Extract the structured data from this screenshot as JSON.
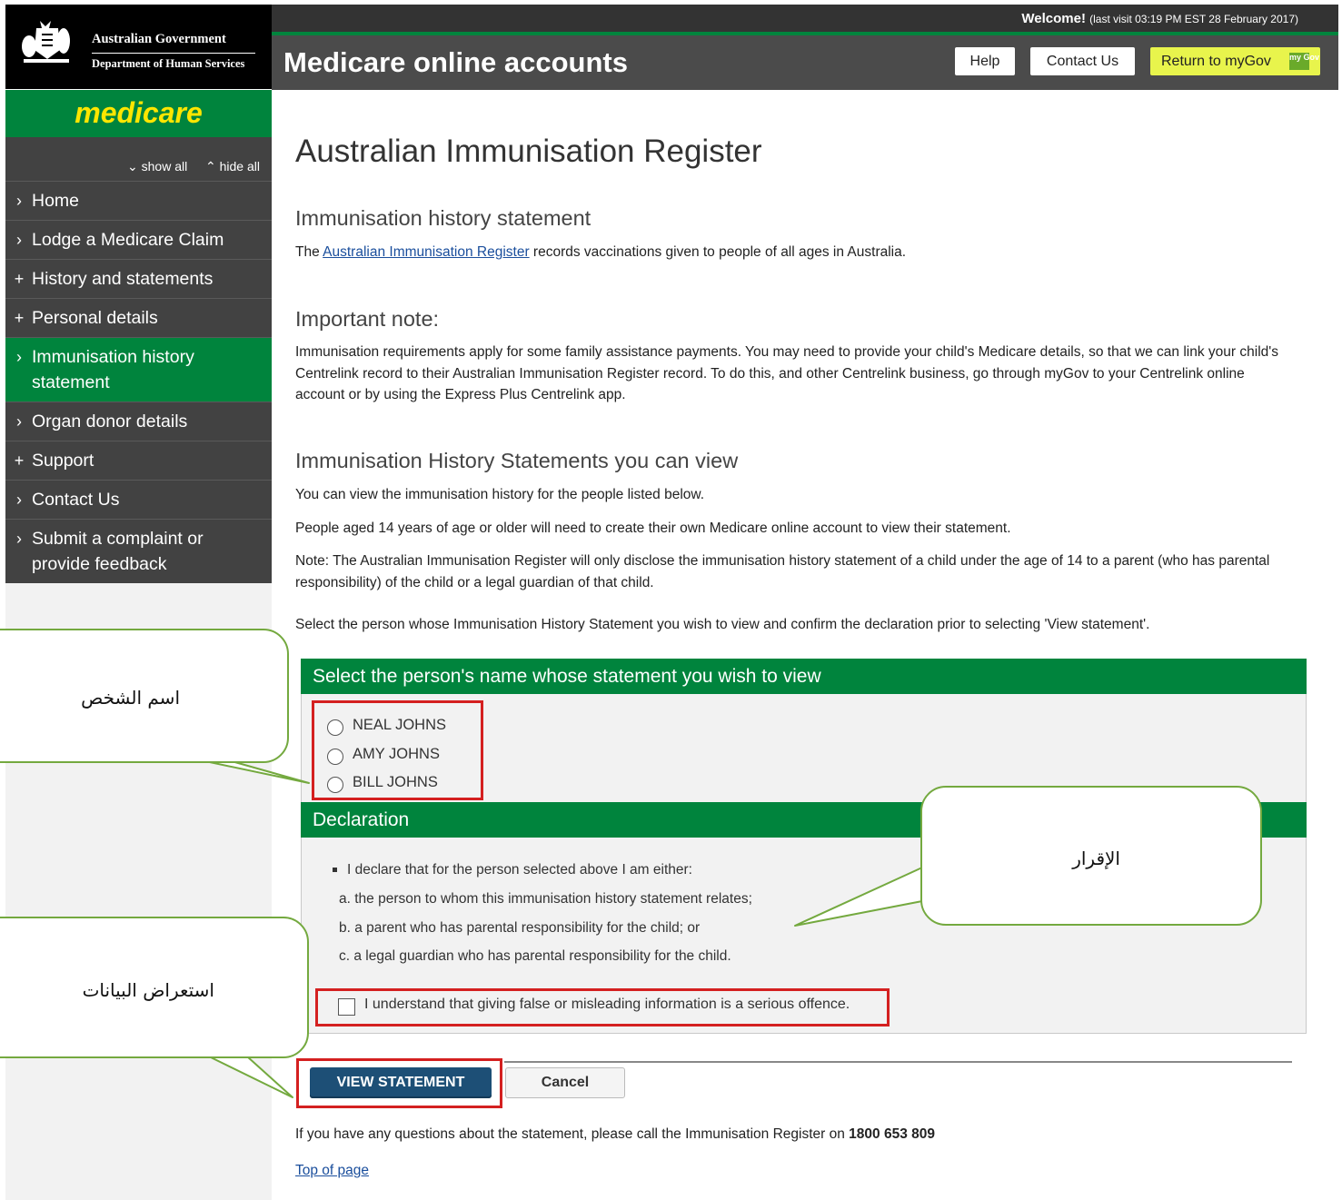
{
  "header": {
    "gov_name": "Australian Government",
    "dept_name": "Department of Human Services",
    "welcome_bold": "Welcome!",
    "welcome_detail": "(last visit 03:19 PM EST 28 February 2017)",
    "app_title": "Medicare online accounts",
    "help_label": "Help",
    "contact_label": "Contact Us",
    "mygov_label": "Return to myGov",
    "mygov_icon_text": "my Gov"
  },
  "sidebar": {
    "brand": "medicare",
    "show_all": "show all",
    "hide_all": "hide all",
    "items": [
      {
        "label": "Home",
        "mark": "›"
      },
      {
        "label": "Lodge a Medicare Claim",
        "mark": "›"
      },
      {
        "label": "History and statements",
        "mark": "+"
      },
      {
        "label": "Personal details",
        "mark": "+"
      },
      {
        "label": "Immunisation history statement",
        "mark": "›"
      },
      {
        "label": "Organ donor details",
        "mark": "›"
      },
      {
        "label": "Support",
        "mark": "+"
      },
      {
        "label": "Contact Us",
        "mark": "›"
      },
      {
        "label": "Submit a complaint or provide feedback",
        "mark": "›"
      }
    ]
  },
  "main": {
    "page_title": "Australian Immunisation Register",
    "section1_heading": "Immunisation history statement",
    "section1_text_pre": "The ",
    "section1_link": "Australian Immunisation Register",
    "section1_text_post": " records vaccinations given to people of all ages in Australia.",
    "note_heading": "Important note:",
    "note_text": "Immunisation requirements apply for some family assistance payments. You may need to provide your child's Medicare details, so that we can link your child's Centrelink record to their Australian Immunisation Register record. To do this, and other Centrelink business, go through myGov to your Centrelink online account or by using the Express Plus Centrelink app.",
    "view_heading": "Immunisation History Statements you can view",
    "view_p1": "You can view the immunisation history for the people listed below.",
    "view_p2": "People aged 14 years of age or older will need to create their own Medicare online account to view their statement.",
    "view_p3": "Note: The Australian Immunisation Register will only disclose the immunisation history statement of a child under the age of 14 to a parent (who has parental responsibility) of the child or a legal guardian of that child.",
    "view_p4": "Select the person whose Immunisation History Statement you wish to view and confirm the declaration prior to selecting 'View statement'."
  },
  "panel": {
    "select_heading": "Select the person's name whose statement you wish to view",
    "people": [
      "NEAL JOHNS",
      "AMY JOHNS",
      "BILL JOHNS"
    ],
    "declaration_heading": "Declaration",
    "declaration_intro": "I declare that for the person selected above I am either:",
    "declaration_items": [
      "a.  the person to whom this immunisation history statement relates;",
      "b.  a parent who has parental responsibility for the child; or",
      "c.  a legal guardian who has parental responsibility for the child."
    ],
    "checkbox_label": "I understand that giving false or misleading information is a serious offence."
  },
  "actions": {
    "view_label": "VIEW STATEMENT",
    "cancel_label": "Cancel"
  },
  "footer": {
    "questions_pre": "If you have any questions about the statement, please call the Immunisation Register on ",
    "phone": "1800 653 809",
    "top_link": "Top of page"
  },
  "callouts": {
    "person_name": "اسم الشخص",
    "declaration": "الإقرار",
    "view_data": "استعراض البيانات"
  },
  "colors": {
    "green": "#00843d",
    "brand_yellow": "#ffe600",
    "highlight_red": "#d42020",
    "callout_border": "#74a93f",
    "view_button": "#1d4f76"
  }
}
